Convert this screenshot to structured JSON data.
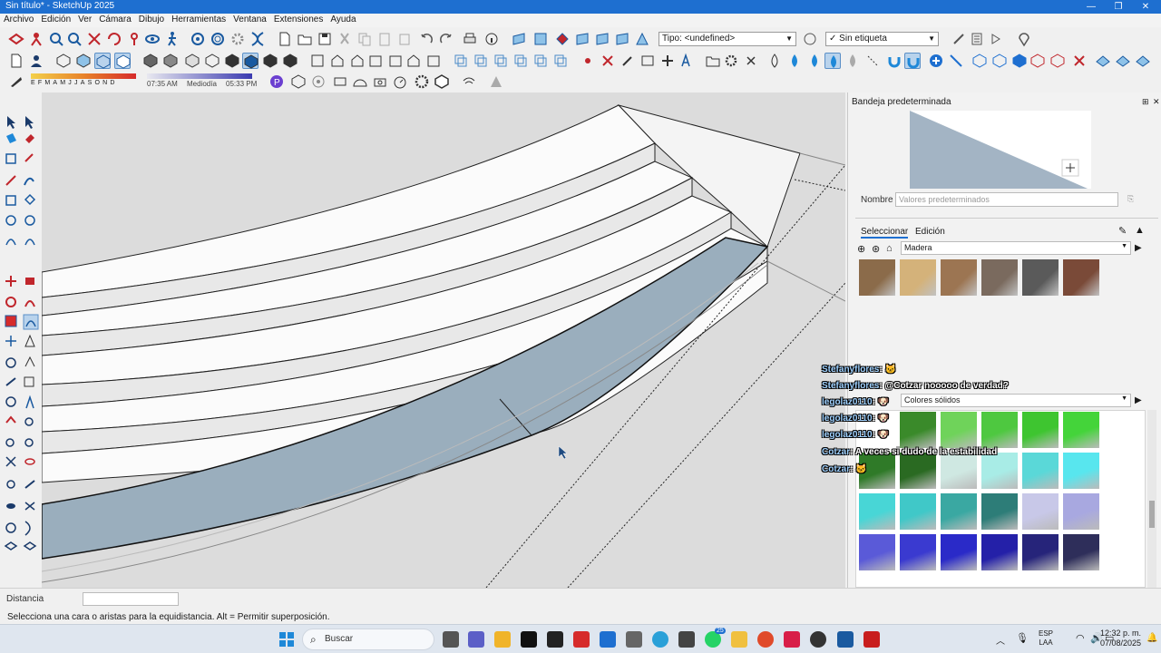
{
  "window": {
    "title": "Sin título* - SketchUp 2025",
    "minimize": "—",
    "restore": "❐",
    "close": "✕"
  },
  "menu": [
    "Archivo",
    "Edición",
    "Ver",
    "Cámara",
    "Dibujo",
    "Herramientas",
    "Ventana",
    "Extensiones",
    "Ayuda"
  ],
  "toolbar": {
    "type_combo": "Tipo: <undefined>",
    "tag_combo": "Sin etiqueta",
    "months": [
      "E",
      "F",
      "M",
      "A",
      "M",
      "J",
      "J",
      "A",
      "S",
      "O",
      "N",
      "D"
    ],
    "time_start": "07:35 AM",
    "time_mid": "Mediodía",
    "time_end": "05:33 PM"
  },
  "tray": {
    "title": "Bandeja predeterminada",
    "name_label": "Nombre",
    "name_placeholder": "Valores predeterminados",
    "tab_select": "Seleccionar",
    "tab_edit": "Edición",
    "collection_top": "Madera",
    "collection_bottom": "Colores sólidos",
    "wood_colors": [
      "#8b6b4a",
      "#d4b27a",
      "#9c7552",
      "#7a6a5e",
      "#5a5a5a",
      "#7a4a38"
    ],
    "solid_rows": [
      [
        "#3a8a2a",
        "#6fd35a",
        "#4ec840",
        "#3ec530",
        "#44d43a"
      ],
      [
        "#2f7a28",
        "#2a6a22",
        "#cfe8e2",
        "#a8ece6",
        "#5ad8d8",
        "#58e6ee"
      ],
      [
        "#48d6d6",
        "#40c8c8",
        "#3aa8a2",
        "#2d7d78",
        "#c8c8e8",
        "#a8a8e0"
      ],
      [
        "#5a5ad8",
        "#3a3ad0",
        "#2a2ac8",
        "#2420a8",
        "#26247a",
        "#2e2e5a"
      ]
    ]
  },
  "chat": [
    {
      "user": "Stefanyflores",
      "msg": ": 🐱"
    },
    {
      "user": "Stefanyflores",
      "msg": ": @Cotzar nooooo de verdad?"
    },
    {
      "user": "legolaz0110",
      "msg": ": 🐶"
    },
    {
      "user": "legolaz0110",
      "msg": ": 🐶"
    },
    {
      "user": "legolaz0110",
      "msg": ": 🐶"
    },
    {
      "user": "Cotzar",
      "msg": ": A veces si dudo de la estabilidad"
    },
    {
      "user": "Cotzar",
      "msg": ": 🐱"
    }
  ],
  "measure": {
    "label": "Distancia",
    "value": ""
  },
  "status": "Selecciona una cara o aristas para la equidistancia. Alt = Permitir superposición.",
  "taskbar": {
    "search": "Buscar",
    "lang1": "ESP",
    "lang2": "LAA",
    "time": "12:32 p. m.",
    "date": "07/08/2025",
    "badge": "25"
  }
}
